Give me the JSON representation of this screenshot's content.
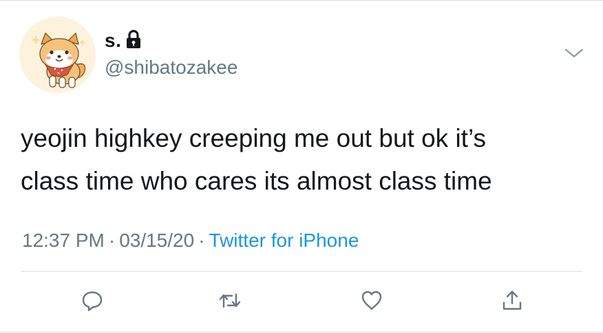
{
  "user": {
    "display_name": "s.",
    "handle": "@shibatozakee",
    "avatar": "shiba-inu-avatar",
    "protected_icon": "lock-icon"
  },
  "tweet": {
    "lines": [
      "yeojin highkey creeping me out but ok it’s",
      "class time who cares its almost class time"
    ]
  },
  "meta": {
    "time": "12:37 PM",
    "separator": "·",
    "date": "03/15/20",
    "source": "Twitter for iPhone"
  },
  "actions": {
    "reply": "reply-icon",
    "retweet": "retweet-icon",
    "like": "heart-icon",
    "share": "share-icon"
  },
  "colors": {
    "text": "#14171a",
    "secondary": "#657786",
    "link": "#1b95e0",
    "divider": "#d9dde1"
  }
}
